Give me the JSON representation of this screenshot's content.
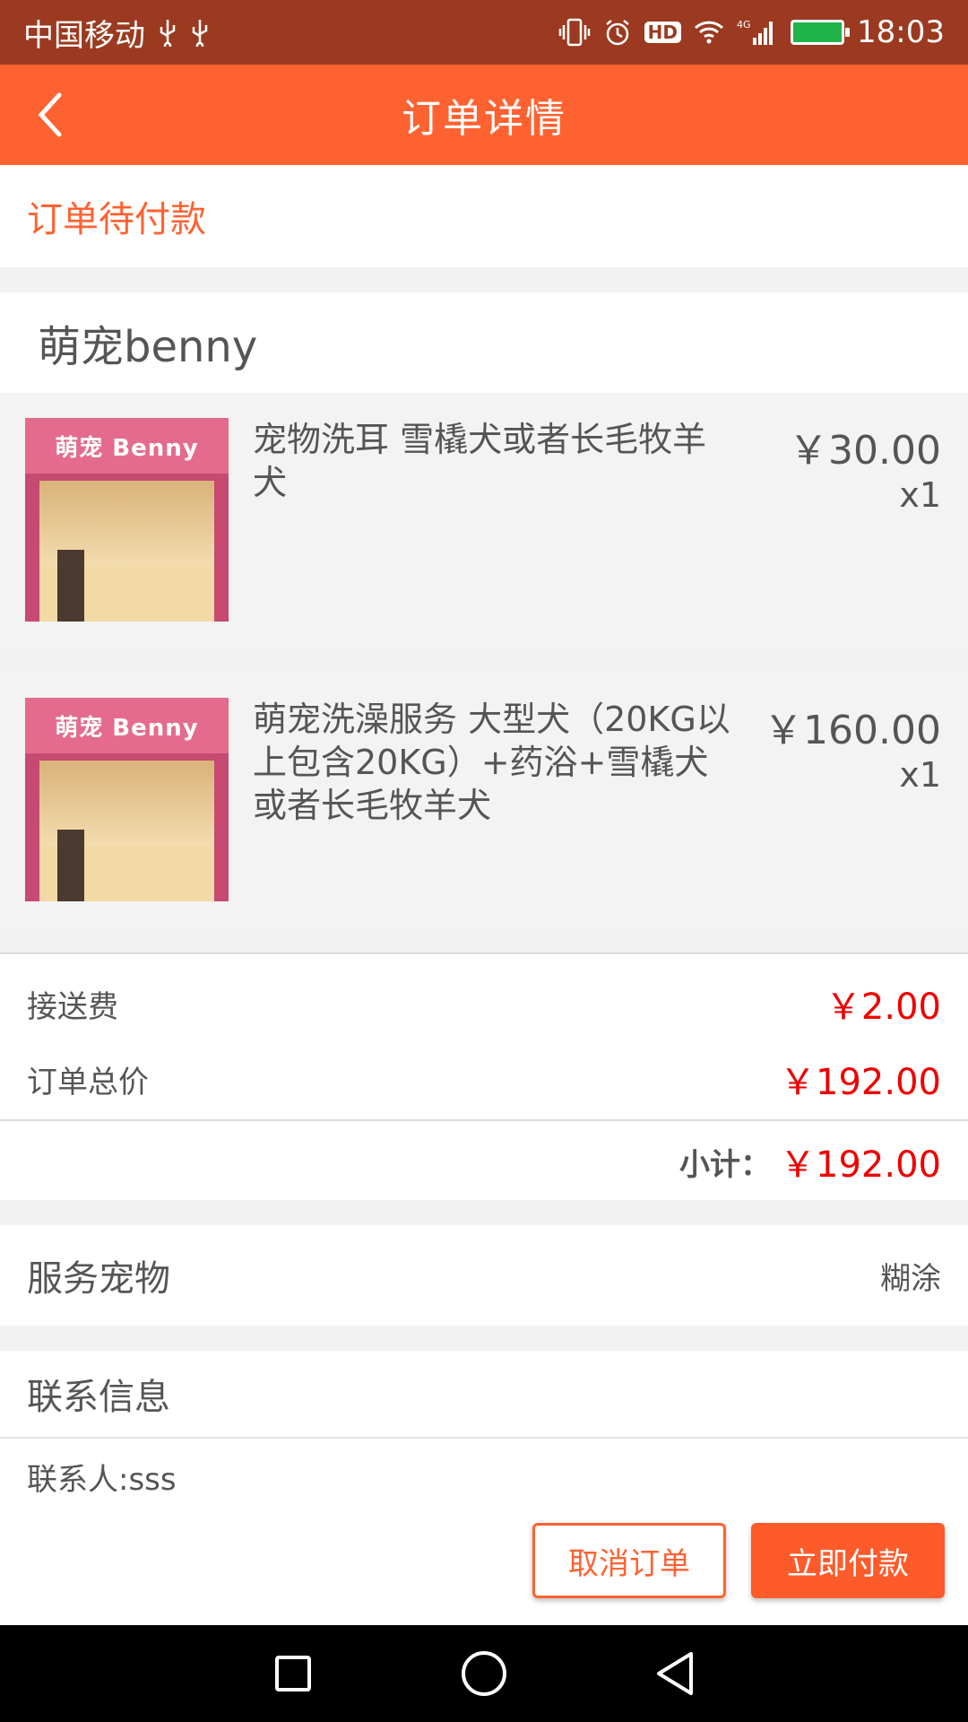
{
  "status_bar": {
    "carrier": "中国移动",
    "time": "18:03",
    "hd": "HD",
    "network": "4G"
  },
  "app_bar": {
    "title": "订单详情"
  },
  "order_status": "订单待付款",
  "shop": {
    "name": "萌宠benny",
    "sign_text": "萌宠 Benny"
  },
  "items": [
    {
      "name": "宠物洗耳 雪橇犬或者长毛牧羊犬",
      "price": "￥30.00",
      "qty": "x1"
    },
    {
      "name": "萌宠洗澡服务 大型犬（20KG以上包含20KG）+药浴+雪橇犬或者长毛牧羊犬",
      "price": "￥160.00",
      "qty": "x1"
    }
  ],
  "fees": {
    "delivery_label": "接送费",
    "delivery_value": "￥2.00",
    "total_label": "订单总价",
    "total_value": "￥192.00",
    "subtotal_label": "小计：",
    "subtotal_value": "￥192.00"
  },
  "pet": {
    "label": "服务宠物",
    "value": "糊涂"
  },
  "contact": {
    "title": "联系信息",
    "person": "联系人:sss"
  },
  "actions": {
    "cancel_label": "取消订单",
    "pay_label": "立即付款"
  },
  "colors": {
    "accent": "#ff6231",
    "status_bar": "#9b3a20",
    "price_red": "#e00000"
  }
}
